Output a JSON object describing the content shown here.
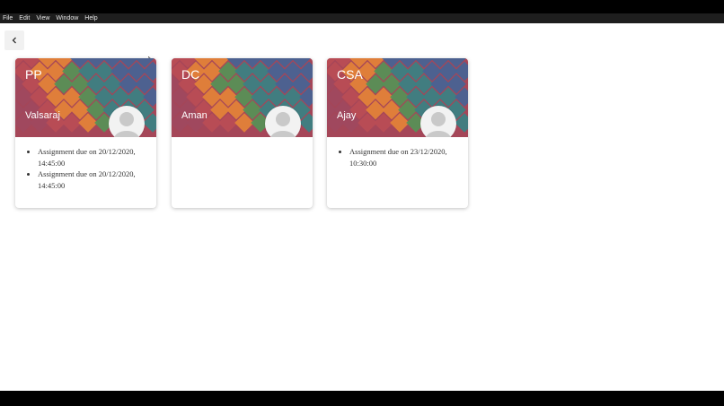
{
  "menu": [
    "File",
    "Edit",
    "View",
    "Window",
    "Help"
  ],
  "back_button": {
    "icon": "chevron-left-icon"
  },
  "colors": {
    "header_stripes": [
      "#c6515b",
      "#f28b3c",
      "#5b9b5c",
      "#3d8a8d",
      "#4a6aa0",
      "#a94d65"
    ]
  },
  "cards": [
    {
      "code": "PP",
      "teacher": "Valsaraj",
      "assignments": [
        "Assignment due on 20/12/2020, 14:45:00",
        "Assignment due on 20/12/2020, 14:45:00"
      ]
    },
    {
      "code": "DC",
      "teacher": "Aman",
      "assignments": []
    },
    {
      "code": "CSA",
      "teacher": "Ajay",
      "assignments": [
        "Assignment due on 23/12/2020, 10:30:00"
      ]
    }
  ]
}
